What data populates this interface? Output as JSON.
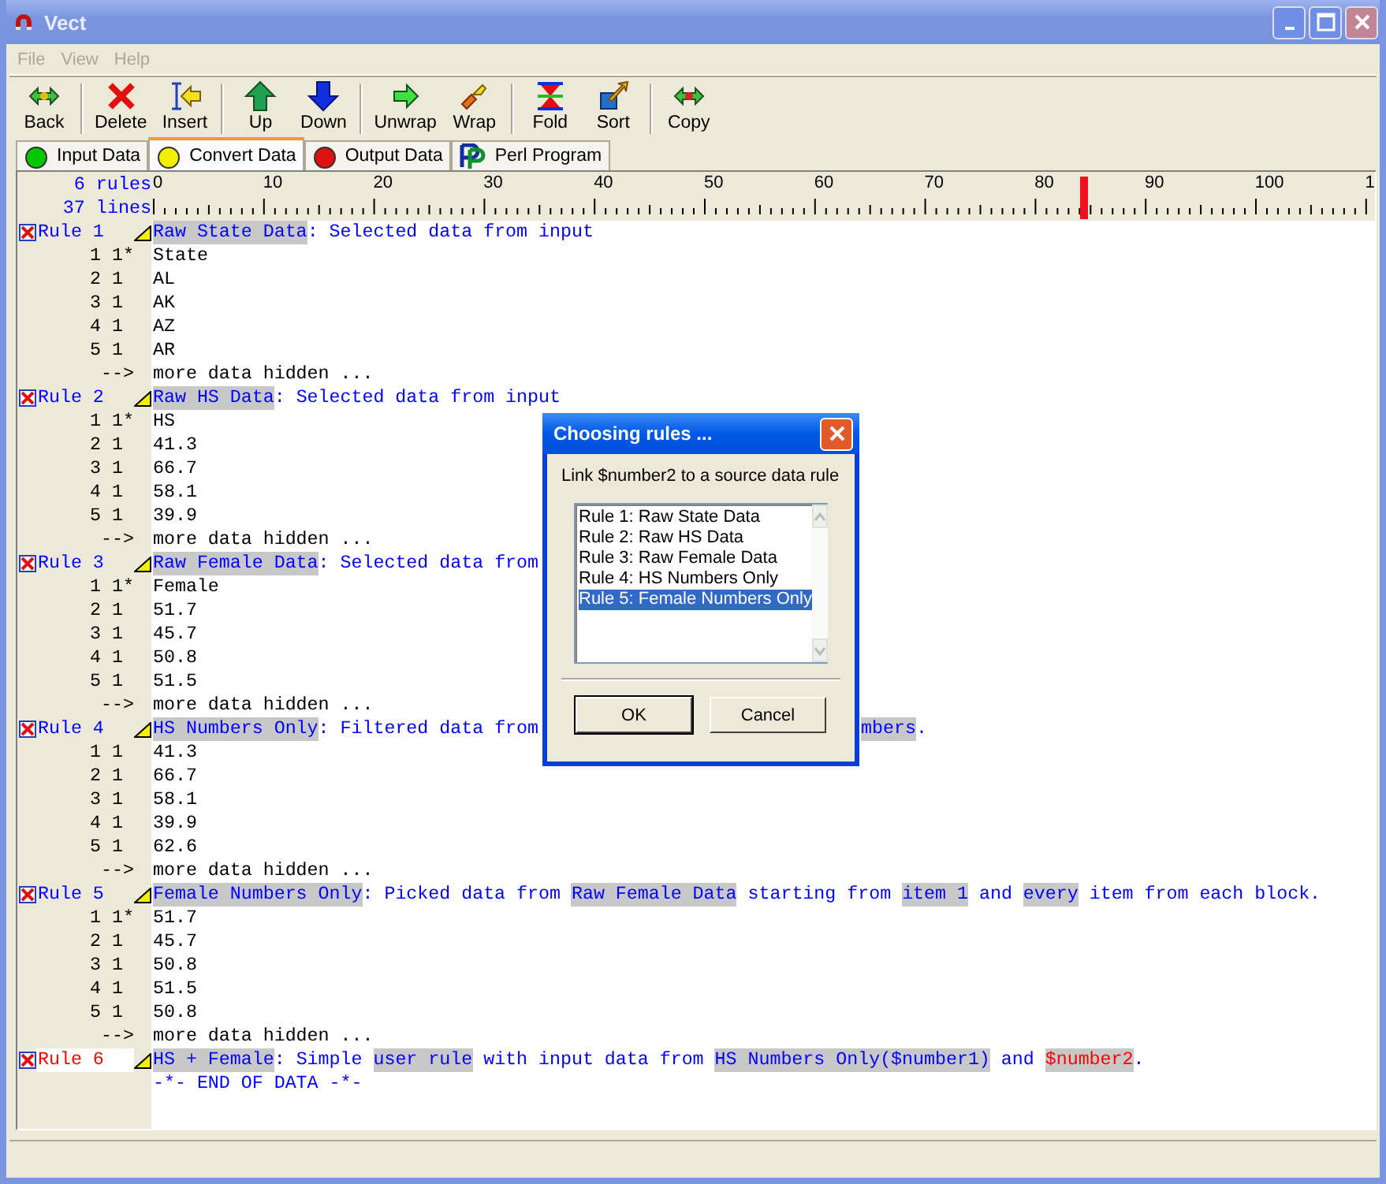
{
  "window": {
    "title": "Vect"
  },
  "menu": [
    {
      "label": "File",
      "disabled": true
    },
    {
      "label": "View",
      "disabled": true
    },
    {
      "label": "Help",
      "disabled": true
    }
  ],
  "toolbar": [
    {
      "label": "Back",
      "kind": "back",
      "separator_before": false
    },
    {
      "label": "Delete",
      "kind": "delete",
      "separator_before": true
    },
    {
      "label": "Insert",
      "kind": "insert",
      "separator_before": false
    },
    {
      "label": "Up",
      "kind": "up",
      "separator_before": true
    },
    {
      "label": "Down",
      "kind": "down",
      "separator_before": false
    },
    {
      "label": "Unwrap",
      "kind": "unwrap",
      "separator_before": true
    },
    {
      "label": "Wrap",
      "kind": "wrap",
      "separator_before": false
    },
    {
      "label": "Fold",
      "kind": "fold",
      "separator_before": true
    },
    {
      "label": "Sort",
      "kind": "sort",
      "separator_before": false
    },
    {
      "label": "Copy",
      "kind": "copy",
      "separator_before": true
    }
  ],
  "tabs": [
    {
      "label": "Input Data",
      "selected": false,
      "kind": "lamp",
      "color": "#00c800"
    },
    {
      "label": "Convert Data",
      "selected": true,
      "kind": "lamp",
      "color": "#f0f000"
    },
    {
      "label": "Output Data",
      "selected": false,
      "kind": "lamp",
      "color": "#e01010"
    },
    {
      "label": "Perl Program",
      "selected": false,
      "kind": "perl"
    }
  ],
  "editor": {
    "rule_count": "6 rules",
    "line_count": "37 lines",
    "ruler": {
      "labels": [
        "0",
        "10",
        "20",
        "30",
        "40",
        "50",
        "60",
        "70",
        "80",
        "90",
        "100",
        "1"
      ],
      "level": 0.764
    },
    "rules": [
      {
        "label": "Rule 1",
        "current": false,
        "segments": [
          {
            "text": "Raw State Data",
            "highlight": true,
            "warning": false
          },
          {
            "text": ": Selected data from input",
            "highlight": false,
            "warning": false
          }
        ],
        "rows": [
          {
            "n": "1",
            "count": "1*",
            "value": "State"
          },
          {
            "n": "2",
            "count": "1",
            "value": "AL"
          },
          {
            "n": "3",
            "count": "1",
            "value": "AK"
          },
          {
            "n": "4",
            "count": "1",
            "value": "AZ"
          },
          {
            "n": "5",
            "count": "1",
            "value": "AR"
          }
        ],
        "more": {
          "arrow": "-->",
          "text": "more data hidden ..."
        }
      },
      {
        "label": "Rule 2",
        "current": false,
        "segments": [
          {
            "text": "Raw HS Data",
            "highlight": true,
            "warning": false
          },
          {
            "text": ": Selected data from input",
            "highlight": false,
            "warning": false
          }
        ],
        "rows": [
          {
            "n": "1",
            "count": "1*",
            "value": "HS"
          },
          {
            "n": "2",
            "count": "1",
            "value": "41.3"
          },
          {
            "n": "3",
            "count": "1",
            "value": "66.7"
          },
          {
            "n": "4",
            "count": "1",
            "value": "58.1"
          },
          {
            "n": "5",
            "count": "1",
            "value": "39.9"
          }
        ],
        "more": {
          "arrow": "-->",
          "text": "more data hidden ..."
        }
      },
      {
        "label": "Rule 3",
        "current": false,
        "segments": [
          {
            "text": "Raw Female Data",
            "highlight": true,
            "warning": false
          },
          {
            "text": ": Selected data from",
            "highlight": false,
            "warning": false
          }
        ],
        "rows": [
          {
            "n": "1",
            "count": "1*",
            "value": "Female"
          },
          {
            "n": "2",
            "count": "1",
            "value": "51.7"
          },
          {
            "n": "3",
            "count": "1",
            "value": "45.7"
          },
          {
            "n": "4",
            "count": "1",
            "value": "50.8"
          },
          {
            "n": "5",
            "count": "1",
            "value": "51.5"
          }
        ],
        "more": {
          "arrow": "-->",
          "text": "more data hidden ..."
        }
      },
      {
        "label": "Rule 4",
        "current": false,
        "segments": [
          {
            "text": "HS Numbers Only",
            "highlight": true,
            "warning": false
          },
          {
            "text": ": Filtered data from",
            "highlight": false,
            "warning": false
          }
        ],
        "tail": [
          {
            "text": "mbers",
            "highlight": true,
            "warning": false
          },
          {
            "text": ".",
            "highlight": false,
            "warning": false
          }
        ],
        "rows": [
          {
            "n": "1",
            "count": "1",
            "value": "41.3"
          },
          {
            "n": "2",
            "count": "1",
            "value": "66.7"
          },
          {
            "n": "3",
            "count": "1",
            "value": "58.1"
          },
          {
            "n": "4",
            "count": "1",
            "value": "39.9"
          },
          {
            "n": "5",
            "count": "1",
            "value": "62.6"
          }
        ],
        "more": {
          "arrow": "-->",
          "text": "more data hidden ..."
        }
      },
      {
        "label": "Rule 5",
        "current": false,
        "segments": [
          {
            "text": "Female Numbers Only",
            "highlight": true,
            "warning": false
          },
          {
            "text": ": Picked data from ",
            "highlight": false,
            "warning": false
          },
          {
            "text": "Raw Female Data",
            "highlight": true,
            "warning": false
          },
          {
            "text": " starting from ",
            "highlight": false,
            "warning": false
          },
          {
            "text": "item 1",
            "highlight": true,
            "warning": false
          },
          {
            "text": " and ",
            "highlight": false,
            "warning": false
          },
          {
            "text": "every",
            "highlight": true,
            "warning": false
          },
          {
            "text": " item from each block.",
            "highlight": false,
            "warning": false
          }
        ],
        "rows": [
          {
            "n": "1",
            "count": "1*",
            "value": "51.7"
          },
          {
            "n": "2",
            "count": "1",
            "value": "45.7"
          },
          {
            "n": "3",
            "count": "1",
            "value": "50.8"
          },
          {
            "n": "4",
            "count": "1",
            "value": "51.5"
          },
          {
            "n": "5",
            "count": "1",
            "value": "50.8"
          }
        ],
        "more": {
          "arrow": "-->",
          "text": "more data hidden ..."
        }
      },
      {
        "label": "Rule 6",
        "current": true,
        "segments": [
          {
            "text": "HS + Female",
            "highlight": true,
            "warning": false
          },
          {
            "text": ": Simple ",
            "highlight": false,
            "warning": false
          },
          {
            "text": "user rule",
            "highlight": true,
            "warning": false
          },
          {
            "text": " with input data from ",
            "highlight": false,
            "warning": false
          },
          {
            "text": "HS Numbers Only($number1)",
            "highlight": true,
            "warning": false
          },
          {
            "text": " and ",
            "highlight": false,
            "warning": false
          },
          {
            "text": "$number2",
            "highlight": true,
            "warning": true
          },
          {
            "text": ".",
            "highlight": false,
            "warning": false
          }
        ]
      }
    ],
    "end_marker": "-*- END OF DATA -*-"
  },
  "dialog": {
    "title": "Choosing rules ...",
    "prompt": "Link $number2 to a source data rule",
    "items": [
      {
        "label": "Rule 1: Raw State Data",
        "selected": false
      },
      {
        "label": "Rule 2: Raw HS Data",
        "selected": false
      },
      {
        "label": "Rule 3: Raw Female Data",
        "selected": false
      },
      {
        "label": "Rule 4: HS Numbers Only",
        "selected": false
      },
      {
        "label": "Rule 5: Female Numbers Only",
        "selected": true
      }
    ],
    "buttons": [
      "OK",
      "Cancel"
    ]
  }
}
